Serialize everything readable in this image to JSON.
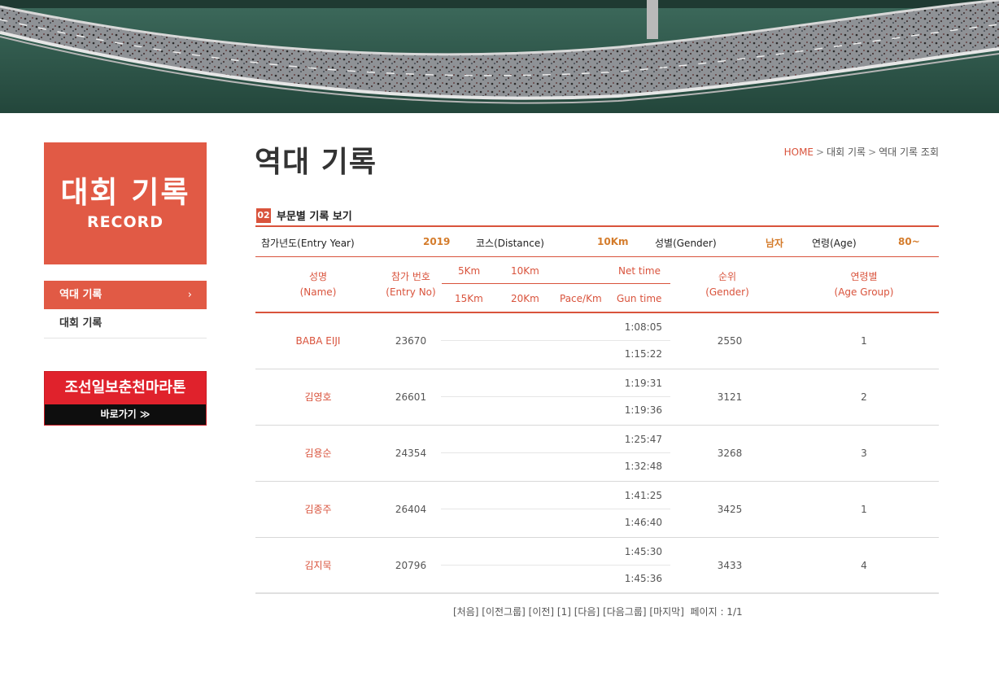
{
  "sidebar": {
    "title_ko": "대회 기록",
    "title_en": "RECORD",
    "items": [
      {
        "label": "역대 기록",
        "chevron": "›"
      },
      {
        "label": "대회 기록"
      }
    ],
    "banner": {
      "title": "조선일보춘천마라톤",
      "link_label": "바로가기 ≫"
    }
  },
  "page": {
    "title": "역대 기록"
  },
  "breadcrumb": {
    "home": "HOME",
    "level1": "대회 기록",
    "level2": "역대 기록 조회",
    "separator": ">"
  },
  "section": {
    "number": "02",
    "label": "부문별 기록 보기"
  },
  "filters": {
    "year_label": "참가년도(Entry Year)",
    "year_value": "2019",
    "course_label": "코스(Distance)",
    "course_value": "10Km",
    "gender_label": "성별(Gender)",
    "gender_value": "남자",
    "age_label": "연령(Age)",
    "age_value": "80~"
  },
  "table": {
    "headers": {
      "name_ko": "성명",
      "name_en": "(Name)",
      "entry_ko": "참가 번호",
      "entry_en": "(Entry No)",
      "km5": "5Km",
      "km10": "10Km",
      "net_time": "Net time",
      "km15": "15Km",
      "km20": "20Km",
      "pace": "Pace/Km",
      "gun_time": "Gun time",
      "rank_ko": "순위",
      "rank_en": "(Gender)",
      "age_ko": "연령별",
      "age_en": "(Age Group)"
    },
    "rows": [
      {
        "name": "BABA EIJI",
        "entry_no": "23670",
        "net_time": "1:08:05",
        "gun_time": "1:15:22",
        "rank": "2550",
        "age_group": "1"
      },
      {
        "name": "김영호",
        "entry_no": "26601",
        "net_time": "1:19:31",
        "gun_time": "1:19:36",
        "rank": "3121",
        "age_group": "2"
      },
      {
        "name": "김용순",
        "entry_no": "24354",
        "net_time": "1:25:47",
        "gun_time": "1:32:48",
        "rank": "3268",
        "age_group": "3"
      },
      {
        "name": "김종주",
        "entry_no": "26404",
        "net_time": "1:41:25",
        "gun_time": "1:46:40",
        "rank": "3425",
        "age_group": "1"
      },
      {
        "name": "김지묵",
        "entry_no": "20796",
        "net_time": "1:45:30",
        "gun_time": "1:45:36",
        "rank": "3433",
        "age_group": "4"
      }
    ]
  },
  "pagination": {
    "first": "[처음]",
    "prev_group": "[이전그룹]",
    "prev": "[이전]",
    "current": "[1]",
    "next": "[다음]",
    "next_group": "[다음그룹]",
    "last": "[마지막]",
    "page_info": "페이지 : 1/1"
  },
  "colors": {
    "accent": "#d9533c",
    "sidebar_box": "#e15a45",
    "banner_red": "#e0222c",
    "value_orange": "#d47c2c"
  }
}
